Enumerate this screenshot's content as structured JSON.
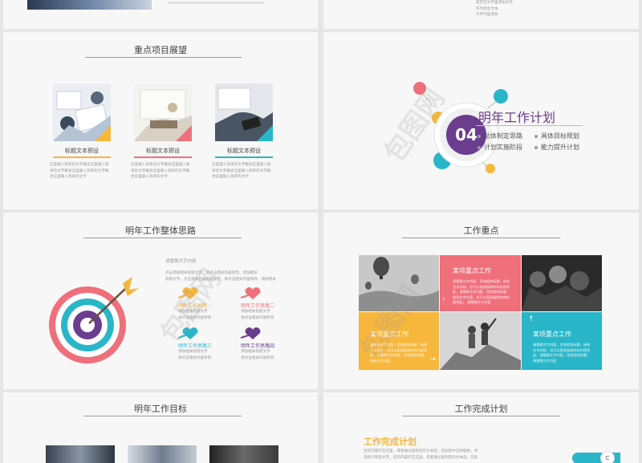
{
  "top_right_text": [
    "是否在文字里添加文字",
    "作为标签文本",
    "文字内容添加"
  ],
  "slide_focus_projects": {
    "title": "重点项目展望",
    "items": [
      {
        "caption": "标题文本预设",
        "accent": "#f6b73c",
        "body": [
          "这里输入简单的文字概述这里输入简",
          "单的文字概述这里输入简单的文字概",
          "述这里输入简单的文字"
        ]
      },
      {
        "caption": "标题文本预设",
        "accent": "#ef6f7b",
        "body": [
          "这里输入简单的文字概述这里输入简",
          "单的文字概述这里输入简单的文字概",
          "述这里输入简单的文字"
        ]
      },
      {
        "caption": "标题文本预设",
        "accent": "#29b6c9",
        "body": [
          "这里输入简单的文字概述这里输入简",
          "单的文字概述这里输入简单的文字概",
          "述这里输入简单的文字"
        ]
      }
    ]
  },
  "slide_next_year_plan": {
    "number": "04",
    "title": "明年工作计划",
    "bullets": [
      "总体制定思路",
      "具体目标规划",
      "计划实施阶段",
      "能力提升计划"
    ]
  },
  "slide_overall_idea": {
    "title": "明年工作整体思路",
    "subhead": "请替换文字内容",
    "intro": [
      "点击添加相关标题文字，请点击相关内容修改，添加相关",
      "标题文字，点击添加相关标题文字，请点击相关内容修改，添加相关"
    ],
    "items": [
      {
        "label": "明年工作思路一",
        "color": "#f6b73c",
        "body": [
          "添加相关标题文字",
          "请点击相关内容修改"
        ]
      },
      {
        "label": "明年工作思路二",
        "color": "#ef6f7b",
        "body": [
          "添加相关标题文字",
          "请点击相关内容修改"
        ]
      },
      {
        "label": "明年工作思路三",
        "color": "#29b6c9",
        "body": [
          "添加相关标题文字",
          "请点击相关内容修改"
        ]
      },
      {
        "label": "明年工作思路四",
        "color": "#6a3d8f",
        "body": [
          "添加相关标题文字",
          "请点击相关内容修改"
        ]
      }
    ]
  },
  "slide_work_focus": {
    "title": "工作重点",
    "tiles": [
      {
        "title": "某项重点工作",
        "color": "#ef6f7b",
        "body": [
          "请替换文字内容，添加相关标题，修改",
          "文字内容，也可以直接复制你的内容到",
          "此。请替换文字内容，添加相关标题，",
          "修改文字内容，也可以直接复制你的内",
          "容到此。 请替换文字内容"
        ]
      },
      {
        "title": "某项重点工作",
        "color": "#f6b73c",
        "body": [
          "请替换文字内容，添加相关标题，修改",
          "文字内容，也可以直接复制你的内容到",
          "此。请替换文字内容，添加相关标题，",
          "修改文字内容"
        ]
      },
      {
        "title": "某项重点工作",
        "color": "#29b6c9",
        "body": [
          "请替换文字内容，添加相关标题，修改",
          "文字内容，也可以直接复制你的内容到",
          "此。请替换文字内容，添加相关标题，",
          "请替换文字内容"
        ]
      }
    ]
  },
  "slide_next_year_goals": {
    "title": "明年工作目标"
  },
  "slide_completion_plan": {
    "title": "工作完成计划",
    "subtitle": "工作完成计划",
    "body": [
      "您的内容打在这里，或者通过复制您的文本后，在此框中选择粘贴，并",
      "选择只保留文字。您的内容打在这里，或者通过复制您的文本后，在此"
    ],
    "badge": "C"
  },
  "watermark": "包图网",
  "colors": {
    "yellow": "#f6b73c",
    "pink": "#ef6f7b",
    "teal": "#29b6c9",
    "purple": "#6a3d8f"
  }
}
